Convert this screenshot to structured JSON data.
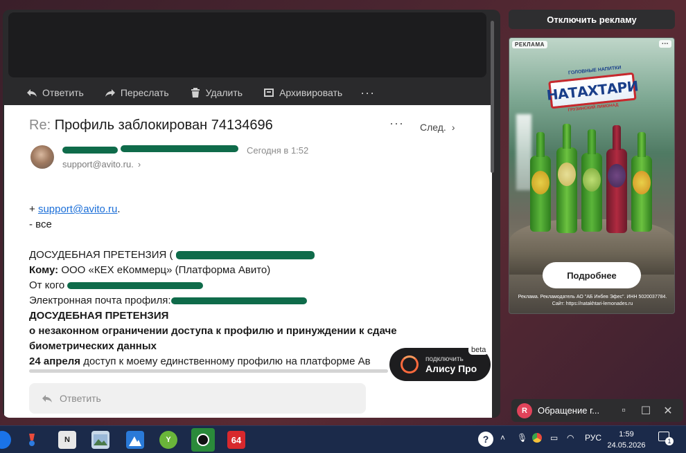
{
  "toolbar": {
    "reply": "Ответить",
    "forward": "Переслать",
    "delete": "Удалить",
    "archive": "Архивировать",
    "more": "···"
  },
  "message": {
    "subject_prefix": "Re:",
    "subject": "Профиль заблокирован 74134696",
    "more": "···",
    "next": "След.",
    "date": "Сегодня в 1:52",
    "sender_email": "support@avito.ru.",
    "body": {
      "line1_prefix": "+ ",
      "line1_link": "support@avito.ru",
      "line1_suffix": ".",
      "line2": "- все",
      "claim_title": "ДОСУДЕБНАЯ ПРЕТЕНЗИЯ  (",
      "to_label": "Кому:",
      "to_value": " ООО «КЕХ еКоммерц» (Платформа Авито)",
      "from_label": "От кого",
      "email_label": "Электронная почта профиля:",
      "heading": "ДОСУДЕБНАЯ ПРЕТЕНЗИЯ",
      "subheading1": "о незаконном ограничении доступа к профилю и принуждении к сдаче",
      "subheading2": "биометрических данных",
      "last_bold": "24 апреля",
      "last_rest": " доступ к моему единственному профилю на платформе Ав"
    },
    "reply_placeholder": "Ответить"
  },
  "alice": {
    "small": "подключить",
    "big": "Алису Про",
    "badge": "beta"
  },
  "ads": {
    "disable_button": "Отключить рекламу",
    "label": "РЕКЛАМА",
    "dots": "···",
    "brand_top": "ГОЛОВНЫЕ НАПИТКИ",
    "brand": "НАТАХТАРИ",
    "brand_sub": "ГРУЗИНСКИЙ ЛИМОНАД",
    "more_button": "Подробнее",
    "disclaimer": "Реклама. Рекламодатель АО \"АБ Инбев Эфес\". ИНН 5020037784. Сайт: https://natakhtari-lemonades.ru"
  },
  "notification": {
    "initial": "R",
    "title": "Обращение г...",
    "restore": "▫",
    "maximize": "☐",
    "close": "✕"
  },
  "taskbar": {
    "badge64": "64",
    "lang": "РУС",
    "time": "1:59",
    "date": "24.05.2026",
    "notif_count": "1"
  },
  "colors": {
    "link": "#1a6ed8",
    "scribble": "#0f6b4a",
    "alice_accent": "#ff6a3d",
    "taskbar": "#1b2a4a"
  }
}
